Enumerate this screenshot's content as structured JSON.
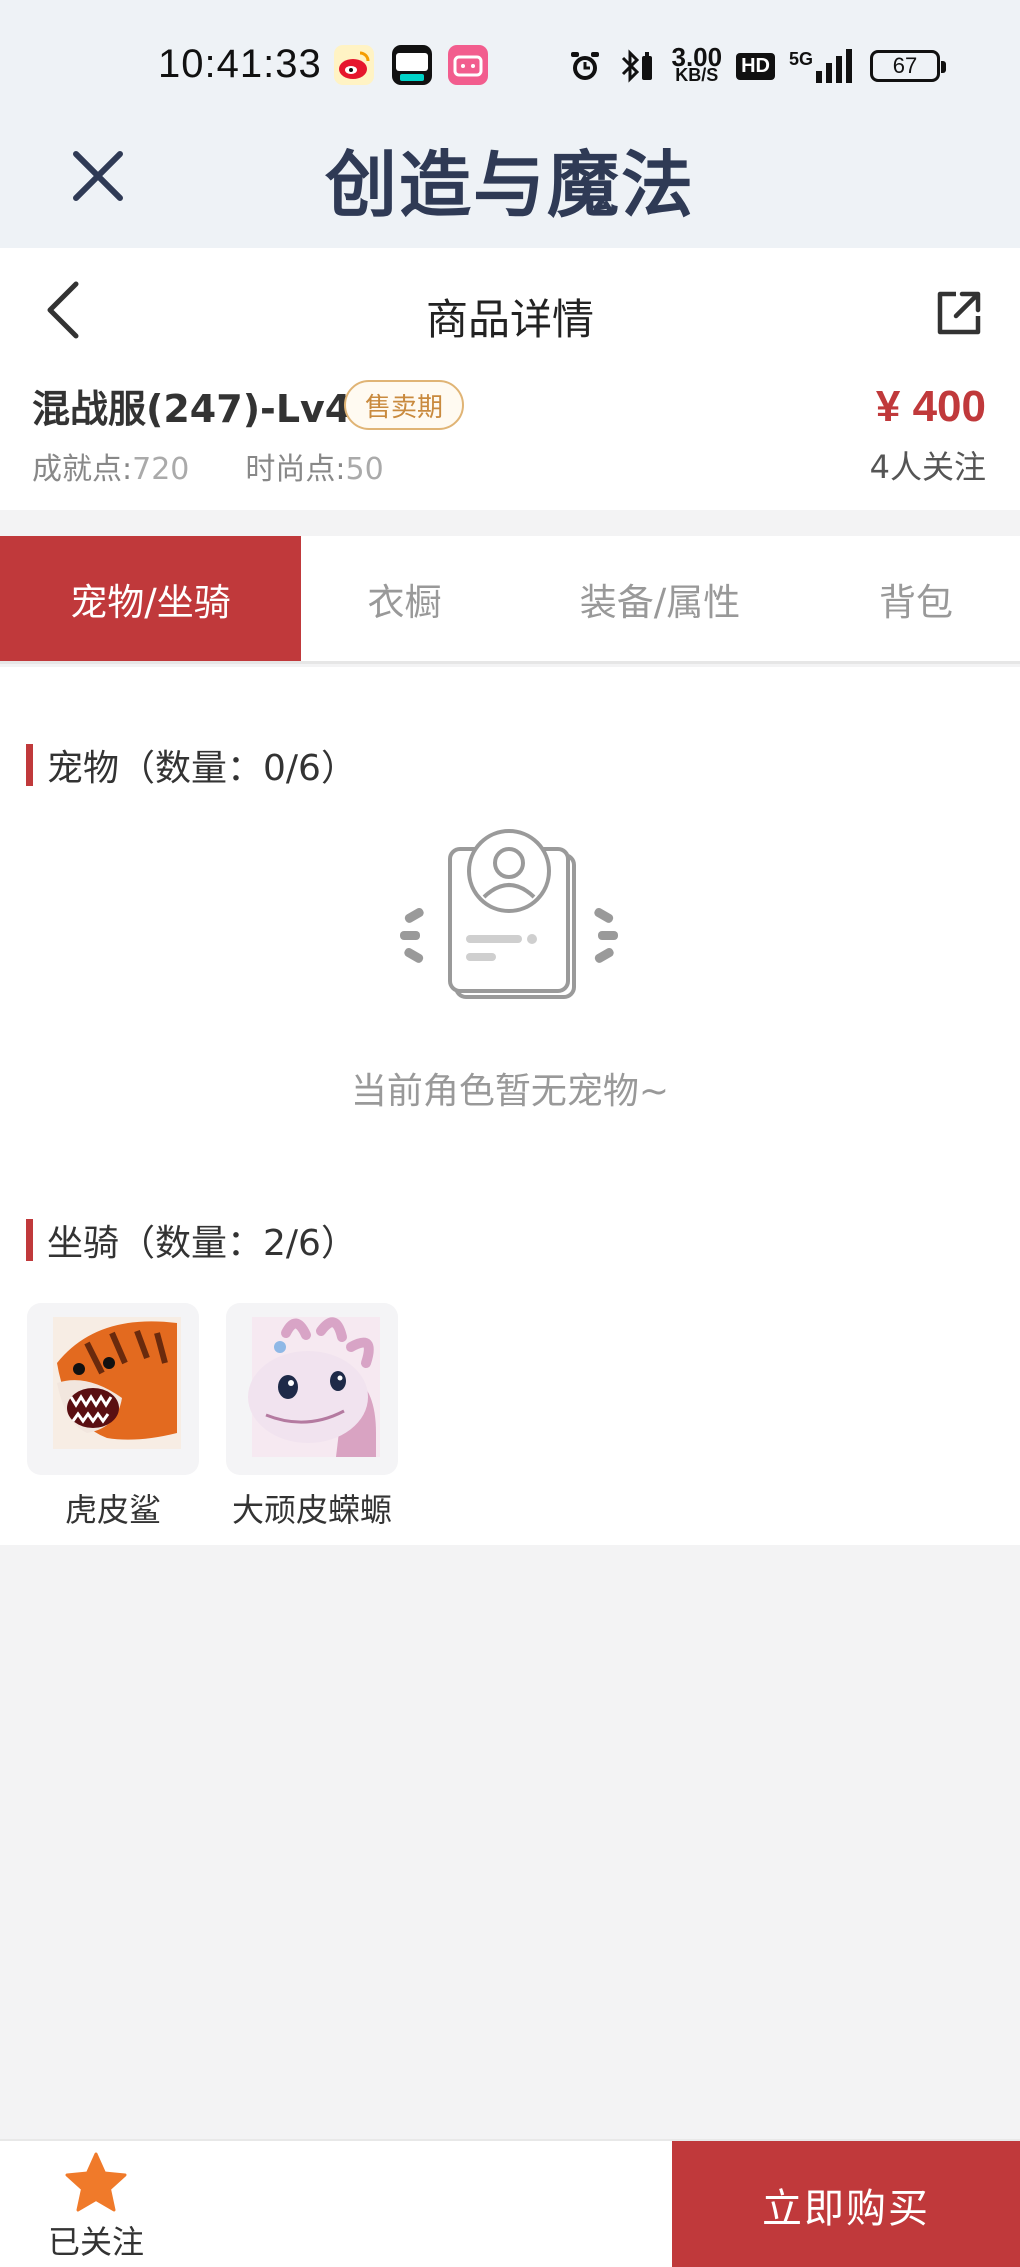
{
  "status_bar": {
    "time": "10:41:33",
    "net_speed_value": "3.00",
    "net_speed_unit": "KB/S",
    "hd": "HD",
    "signal": "5G",
    "battery": "67"
  },
  "title_bar": {
    "title": "创造与魔法"
  },
  "detail": {
    "header_title": "商品详情",
    "item_name": "混战服(247)-Lv40",
    "status_badge": "售卖期",
    "price": "¥ 400",
    "achievement_label": "成就点:",
    "achievement_value": "720",
    "fashion_label": "时尚点:",
    "fashion_value": "50",
    "followers": "4人关注"
  },
  "tabs": [
    {
      "label": "宠物/坐骑",
      "active": true
    },
    {
      "label": "衣橱",
      "active": false
    },
    {
      "label": "装备/属性",
      "active": false
    },
    {
      "label": "背包",
      "active": false
    }
  ],
  "pets": {
    "title": "宠物（数量：0/6）",
    "empty_text": "当前角色暂无宠物~"
  },
  "mounts": {
    "title": "坐骑（数量：2/6）",
    "items": [
      {
        "name": "虎皮鲨",
        "icon": "tiger-shark-icon"
      },
      {
        "name": "大顽皮蝾螈",
        "icon": "axolotl-icon"
      }
    ]
  },
  "bottom": {
    "follow_label": "已关注",
    "buy_label": "立即购买"
  },
  "colors": {
    "accent": "#c0393b",
    "badge": "#c98a3e",
    "star": "#f07a2a"
  }
}
